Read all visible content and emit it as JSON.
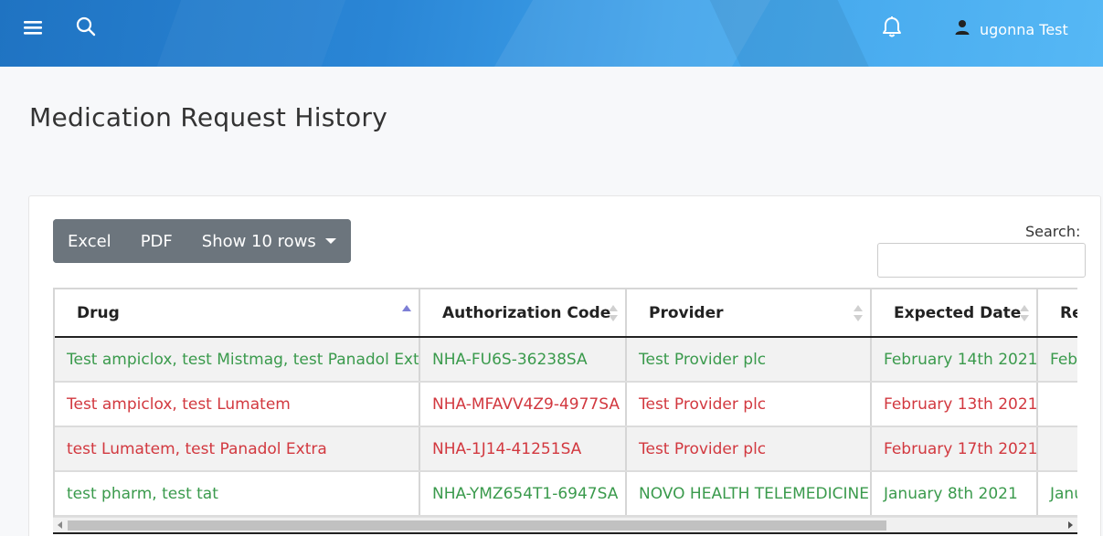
{
  "header": {
    "user_name": "ugonna Test",
    "menu_icon": "hamburger-menu-icon",
    "search_icon": "search-icon",
    "notification_icon": "bell-icon",
    "user_icon": "user-icon"
  },
  "page": {
    "title": "Medication Request History"
  },
  "toolbar": {
    "excel_label": "Excel",
    "pdf_label": "PDF",
    "rows_label": "Show 10 rows"
  },
  "search": {
    "label": "Search:",
    "value": ""
  },
  "table": {
    "columns": [
      "Drug",
      "Authorization Code",
      "Provider",
      "Expected Date",
      "Re"
    ],
    "rows": [
      {
        "status_color": "green",
        "cells": [
          "Test ampiclox, test Mistmag, test Panadol Extra",
          "NHA-FU6S-36238SA",
          "Test Provider plc",
          "February 14th 2021",
          "Febr"
        ]
      },
      {
        "status_color": "red",
        "cells": [
          "Test ampiclox, test Lumatem",
          "NHA-MFAVV4Z9-4977SA",
          "Test Provider plc",
          "February 13th 2021",
          ""
        ]
      },
      {
        "status_color": "red",
        "cells": [
          "test Lumatem, test Panadol Extra",
          "NHA-1J14-41251SA",
          "Test Provider plc",
          "February 17th 2021",
          ""
        ]
      },
      {
        "status_color": "green",
        "cells": [
          "test pharm, test tat",
          "NHA-YMZ654T1-6947SA",
          "NOVO HEALTH TELEMEDICINE",
          "January 8th 2021",
          "Janu"
        ]
      }
    ]
  },
  "colors": {
    "green_text": "#3a9a4c",
    "red_text": "#d2383f",
    "button_gray": "#6c757d",
    "sort_active": "#7d7fd6"
  }
}
